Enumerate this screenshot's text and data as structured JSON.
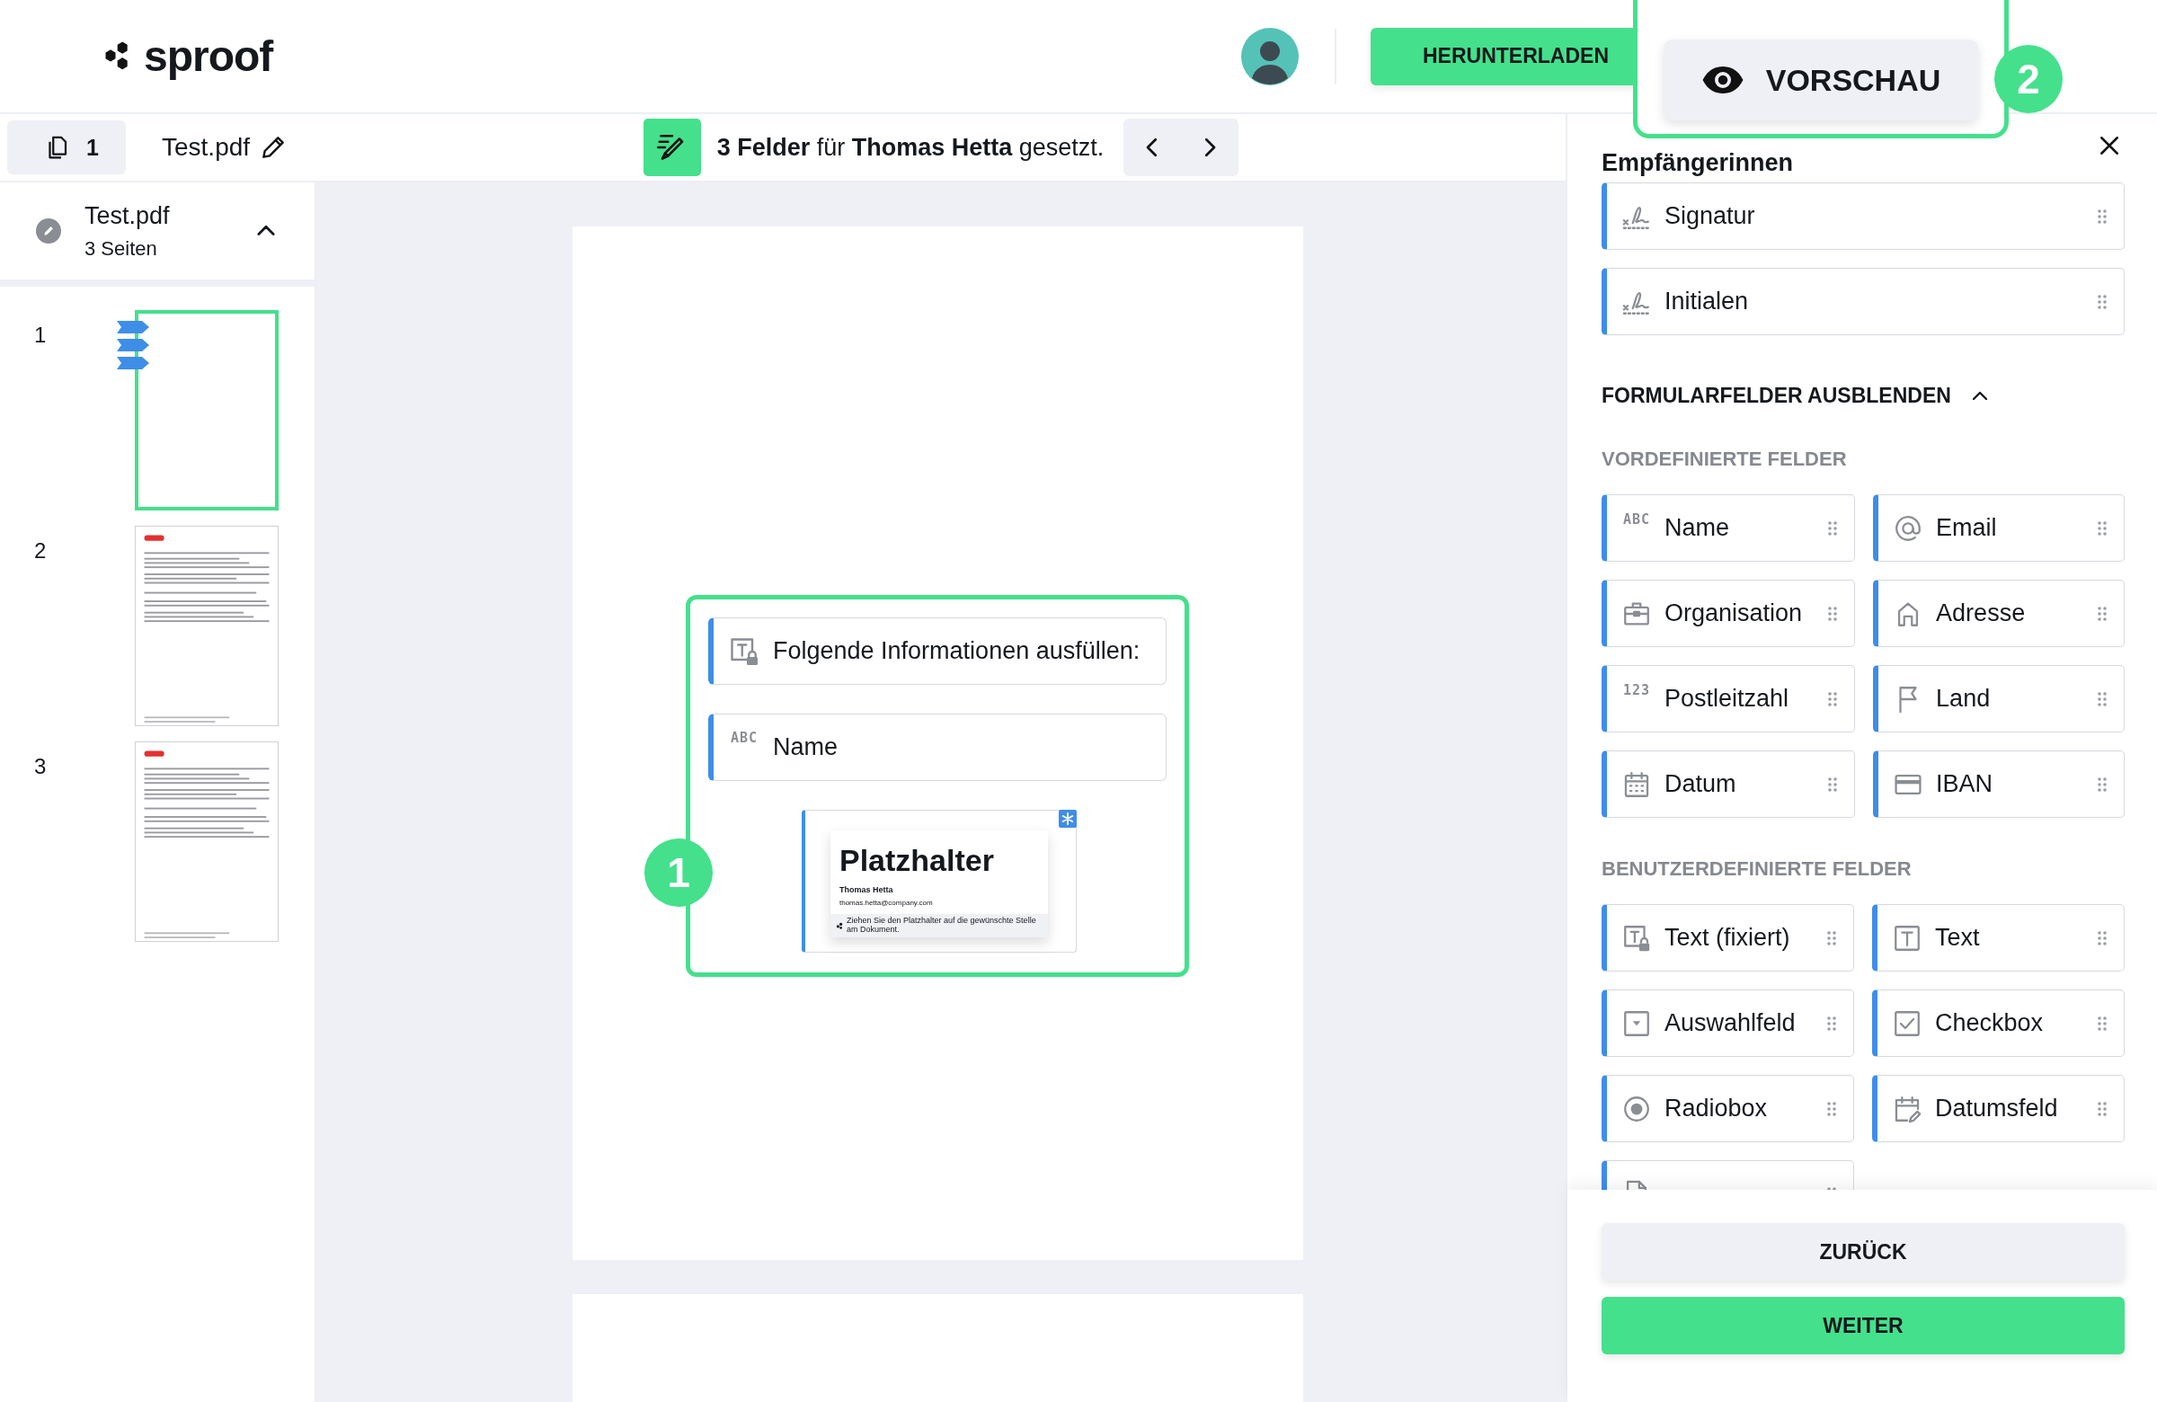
{
  "header": {
    "logo": "sproof",
    "download_button": "HERUNTERLADEN"
  },
  "preview_callout": {
    "button": "VORSCHAU",
    "step": "2"
  },
  "toolbar": {
    "page_count": "1",
    "filename": "Test.pdf",
    "status": "**3 Felder** für **Thomas Hetta** gesetzt."
  },
  "sidebar": {
    "document": {
      "title": "Test.pdf",
      "subtitle": "3 Seiten",
      "expanded": true
    },
    "pages": [
      {
        "number": "1",
        "selected": true,
        "kind": "blank",
        "field_markers": [
          {
            "kind": "field"
          },
          {
            "kind": "field"
          },
          {
            "kind": "field"
          }
        ]
      },
      {
        "number": "2",
        "selected": false,
        "kind": "document"
      },
      {
        "number": "3",
        "selected": false,
        "kind": "document"
      }
    ]
  },
  "document_view": {
    "callout": {
      "step": "1",
      "fields": [
        {
          "kind": "text-lock",
          "label": "Folgende Informationen ausfüllen:"
        },
        {
          "kind": "letters",
          "icon_text": "ABC",
          "label": "Name"
        }
      ],
      "placeholder": {
        "title": "Platzhalter",
        "name": "Thomas Hetta",
        "email": "thomas.hetta@company.com",
        "hint": "Ziehen Sie den Platzhalter auf die gewünschte Stelle am Dokument."
      }
    }
  },
  "panel": {
    "title": "Empfängerinnen",
    "signature_fields": [
      {
        "kind": "signature",
        "label": "Signatur"
      },
      {
        "kind": "signature",
        "label": "Initialen"
      }
    ],
    "toggle": {
      "label": "FORMULARFELDER AUSBLENDEN",
      "expanded": true
    },
    "sections": [
      {
        "title": "VORDEFINIERTE FELDER",
        "fields": [
          {
            "kind": "letters",
            "icon_text": "ABC",
            "label": "Name"
          },
          {
            "kind": "at",
            "label": "Email"
          },
          {
            "kind": "briefcase",
            "label": "Organisation"
          },
          {
            "kind": "home",
            "label": "Adresse"
          },
          {
            "kind": "letters",
            "icon_text": "123",
            "label": "Postleitzahl"
          },
          {
            "kind": "flag",
            "label": "Land"
          },
          {
            "kind": "calendar",
            "label": "Datum"
          },
          {
            "kind": "card",
            "label": "IBAN"
          }
        ]
      },
      {
        "title": "BENUTZERDEFINIERTE FELDER",
        "fields": [
          {
            "kind": "text-lock",
            "label": "Text (fixiert)"
          },
          {
            "kind": "text",
            "label": "Text"
          },
          {
            "kind": "select",
            "label": "Auswahlfeld"
          },
          {
            "kind": "checkbox",
            "label": "Checkbox"
          },
          {
            "kind": "radio",
            "label": "Radiobox"
          },
          {
            "kind": "date-edit",
            "label": "Datumsfeld"
          },
          {
            "kind": "file"
          }
        ]
      }
    ],
    "buttons": [
      {
        "label": "ZURÜCK",
        "kind": "secondary"
      },
      {
        "label": "WEITER",
        "kind": "primary"
      }
    ]
  }
}
